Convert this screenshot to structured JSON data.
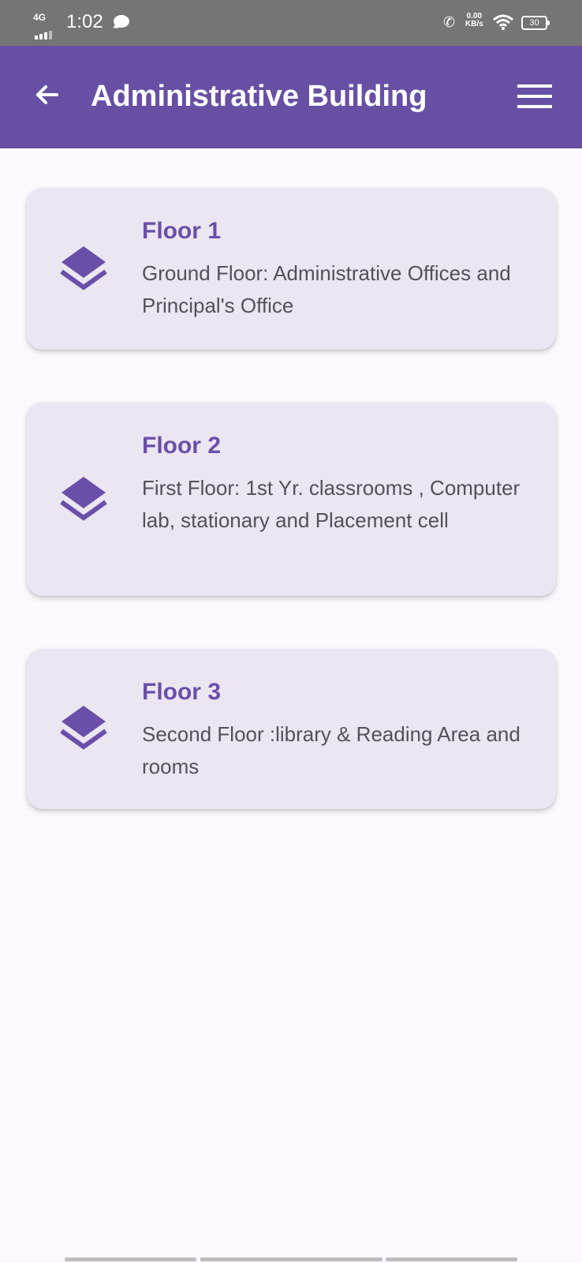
{
  "status_bar": {
    "network": "4G",
    "time": "1:02",
    "speed_value": "0.00",
    "speed_unit": "KB/s",
    "battery": "30"
  },
  "app_bar": {
    "title": "Administrative Building",
    "back_icon": "arrow-left-icon",
    "menu_icon": "menu-icon"
  },
  "floors": [
    {
      "title": "Floor 1",
      "description": "Ground Floor: Administrative Offices and Principal's Office",
      "icon": "layers-icon"
    },
    {
      "title": "Floor 2",
      "description": "First Floor: 1st Yr. classrooms , Computer lab,  stationary and Placement cell",
      "icon": "layers-icon"
    },
    {
      "title": "Floor 3",
      "description": "Second Floor :library & Reading Area and rooms",
      "icon": "layers-icon"
    }
  ],
  "colors": {
    "primary": "#6750a4",
    "card_background": "#ebe6f1",
    "title_text": "#6a4faa",
    "body_text": "#555058",
    "status_bar": "#757575",
    "page_background": "#fdf8fd"
  }
}
